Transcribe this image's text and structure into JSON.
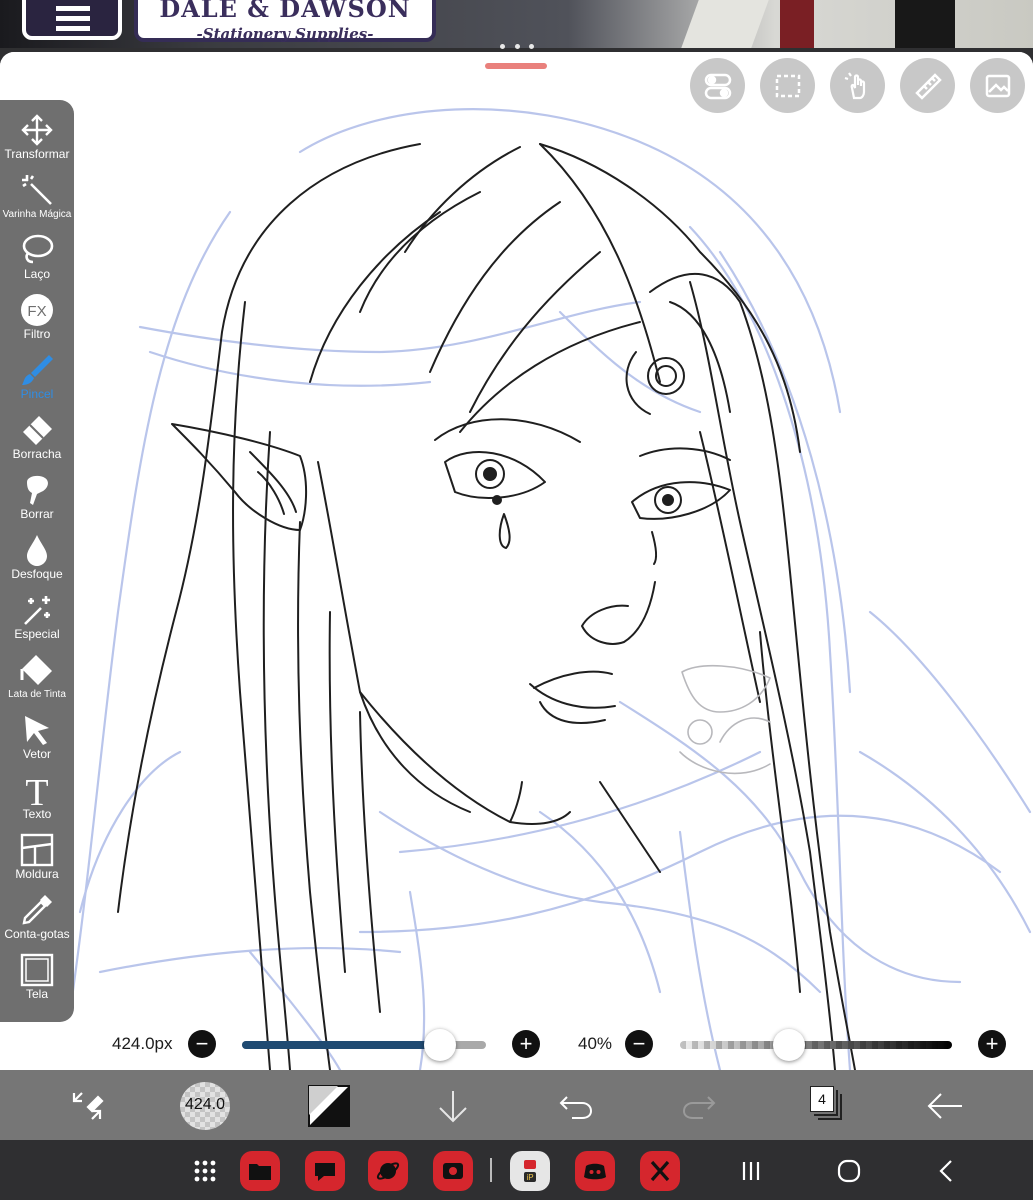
{
  "background_photo": {
    "shop_name": "DALE & DAWSON",
    "shop_subtitle": "-Stationery Supplies-"
  },
  "left_toolbar": {
    "tools": [
      {
        "label": "Transformar",
        "icon": "move-arrows-icon"
      },
      {
        "label": "Varinha Mágica",
        "icon": "magic-wand-icon"
      },
      {
        "label": "Laço",
        "icon": "lasso-icon"
      },
      {
        "label": "Filtro",
        "icon": "fx-filter-icon"
      },
      {
        "label": "Pincel",
        "icon": "brush-icon",
        "active": true
      },
      {
        "label": "Borracha",
        "icon": "eraser-icon"
      },
      {
        "label": "Borrar",
        "icon": "smudge-icon"
      },
      {
        "label": "Desfoque",
        "icon": "blur-drop-icon"
      },
      {
        "label": "Especial",
        "icon": "special-wand-icon"
      },
      {
        "label": "Lata de Tinta",
        "icon": "paint-bucket-icon"
      },
      {
        "label": "Vetor",
        "icon": "vector-cursor-icon"
      },
      {
        "label": "Texto",
        "icon": "text-t-icon"
      },
      {
        "label": "Moldura",
        "icon": "frame-divider-icon"
      },
      {
        "label": "Conta-gotas",
        "icon": "eyedropper-icon"
      },
      {
        "label": "Tela",
        "icon": "canvas-icon"
      }
    ]
  },
  "top_right_tools": [
    "toggle-icon",
    "selection-icon",
    "gesture-hand-icon",
    "ruler-icon",
    "reference-image-icon"
  ],
  "brush_size": {
    "value_label": "424.0px",
    "fraction": 0.81
  },
  "opacity": {
    "value_label": "40%",
    "fraction": 0.4
  },
  "bottom_bar": {
    "brush_preview_label": "424.0",
    "layer_count": "4"
  },
  "colors": {
    "toolbar_bg": "#6f6f6f",
    "active_tool": "#2f8de4",
    "size_track": "#1f4a72",
    "sketch_blue": "#b6c2ea",
    "taskbar_icon": "#d5262d"
  },
  "nav_bar_apps": [
    "apps-grid-icon",
    "folder-app-icon",
    "chat-bubble-app-icon",
    "planet-app-icon",
    "camera-app-icon",
    "ibispaint-app-icon",
    "discord-app-icon",
    "x-app-icon"
  ]
}
